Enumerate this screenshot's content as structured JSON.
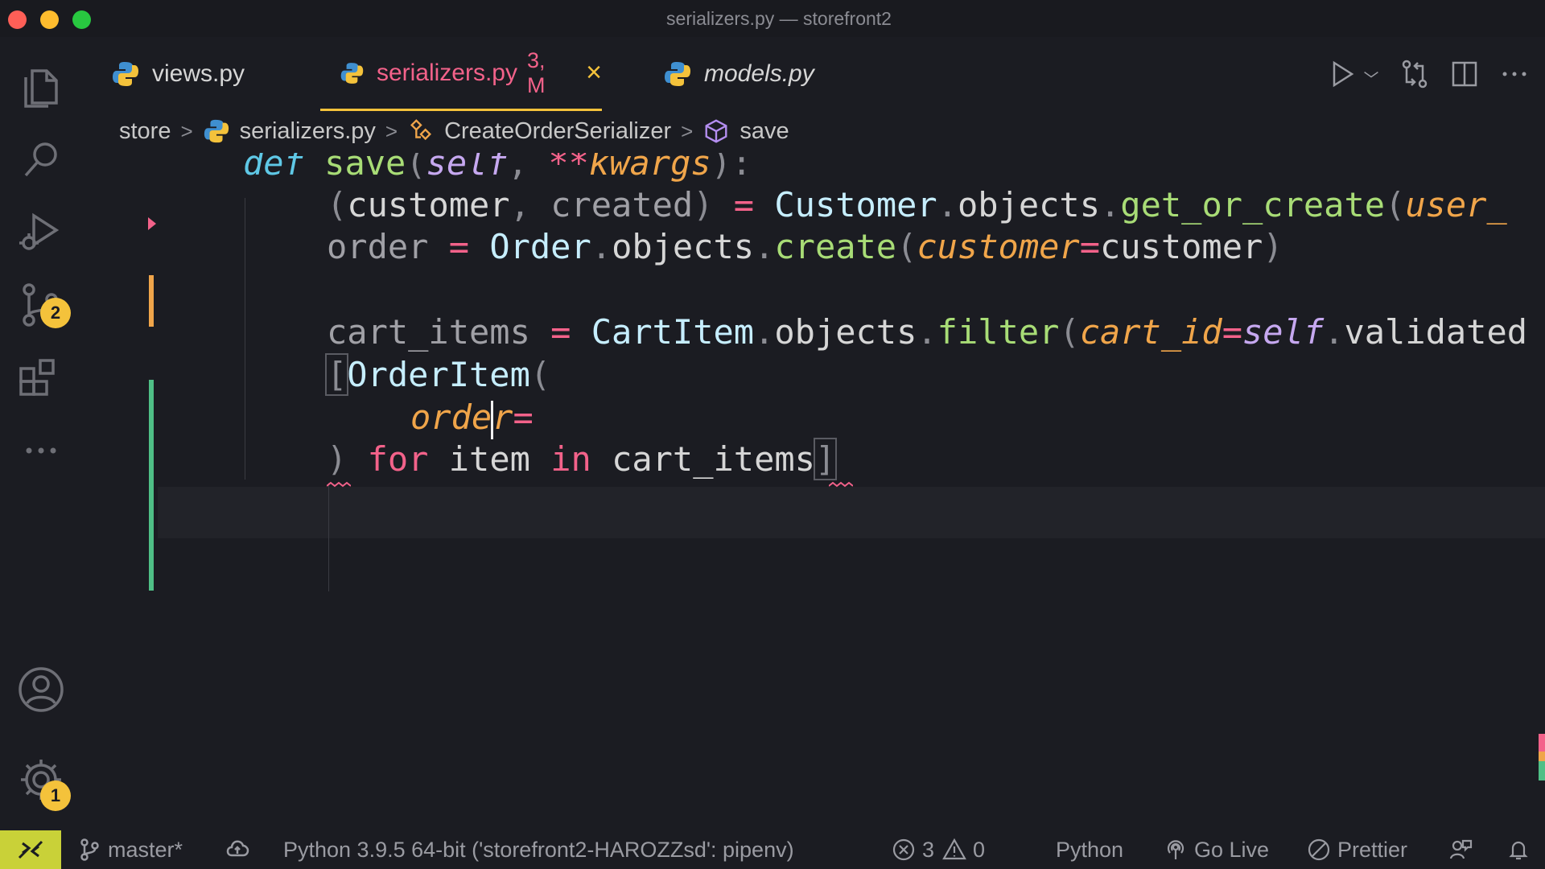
{
  "window": {
    "title": "serializers.py — storefront2"
  },
  "activity_bar": {
    "source_control_badge": "2",
    "settings_badge": "1"
  },
  "tabs": [
    {
      "label": "views.py"
    },
    {
      "label": "serializers.py",
      "status": "3, M",
      "close": "×"
    },
    {
      "label": "models.py"
    }
  ],
  "breadcrumb": {
    "folder": "store",
    "file": "serializers.py",
    "class": "CreateOrderSerializer",
    "method": "save"
  },
  "code": {
    "l1": {
      "def": "def",
      "name": "save",
      "open": "(",
      "self": "self",
      "comma": ",",
      "stars": "**",
      "kwargs": "kwargs",
      "close": "):"
    },
    "l2": {
      "open": "(",
      "customer": "customer",
      "comma": ",",
      "created": "created",
      "close": ")",
      "eq": "=",
      "cls": "Customer",
      "dot1": ".",
      "objects": "objects",
      "dot2": ".",
      "fn": "get_or_create",
      "paren": "(",
      "arg": "user_"
    },
    "l3": {
      "order": "order",
      "eq": "=",
      "cls": "Order",
      "dot1": ".",
      "objects": "objects",
      "dot2": ".",
      "fn": "create",
      "paren": "(",
      "arg": "customer",
      "eq2": "=",
      "val": "customer",
      "close": ")"
    },
    "l5": {
      "var": "cart_items",
      "eq": "=",
      "cls": "CartItem",
      "dot1": ".",
      "objects": "objects",
      "dot2": ".",
      "fn": "filter",
      "paren": "(",
      "arg": "cart_id",
      "eq2": "=",
      "self": "self",
      "dot3": ".",
      "rest": "validated"
    },
    "l6": {
      "bracket": "[",
      "cls": "OrderItem",
      "paren": "("
    },
    "l7": {
      "before_cursor": "orde",
      "after_cursor": "r",
      "eq": "="
    },
    "l8": {
      "close": ")",
      "for": "for",
      "item": "item",
      "in": "in",
      "iter": "cart_items",
      "bracket": "]"
    }
  },
  "status_bar": {
    "branch": "master*",
    "interpreter": "Python 3.9.5 64-bit ('storefront2-HAROZZsd': pipenv)",
    "errors": "3",
    "warnings": "0",
    "language": "Python",
    "go_live": "Go Live",
    "prettier": "Prettier"
  },
  "colors": {
    "accent_yellow": "#f4c23b",
    "modified_tab": "#f3628a",
    "gutter_added": "#4fbf86",
    "gutter_modified": "#f0a54a",
    "remote_button": "#c9d138"
  }
}
